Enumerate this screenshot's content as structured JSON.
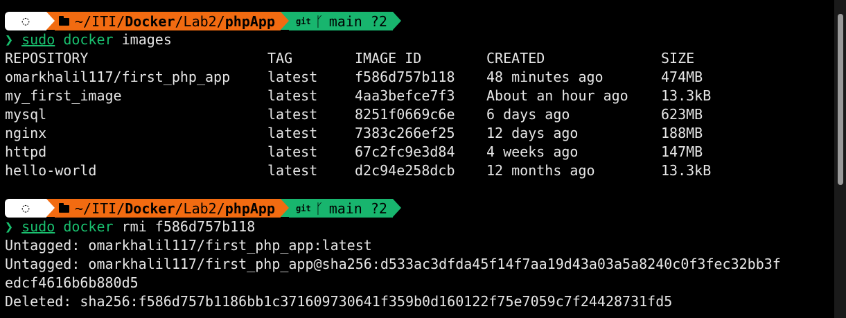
{
  "prompt": {
    "path_prefix": "~/ITI/",
    "path_docker": "Docker",
    "path_sep": "/Lab2/",
    "path_app": "phpApp",
    "git_label": "git",
    "branch": "main ?2",
    "chevron": "❯"
  },
  "command1": {
    "sudo": "sudo",
    "docker": "docker",
    "args": "images"
  },
  "images_table": {
    "headers": [
      "REPOSITORY",
      "TAG",
      "IMAGE ID",
      "CREATED",
      "SIZE"
    ],
    "rows": [
      [
        "omarkhalil117/first_php_app",
        "latest",
        "f586d757b118",
        "48 minutes ago",
        "474MB"
      ],
      [
        "my_first_image",
        "latest",
        "4aa3befce7f3",
        "About an hour ago",
        "13.3kB"
      ],
      [
        "mysql",
        "latest",
        "8251f0669c6e",
        "6 days ago",
        "623MB"
      ],
      [
        "nginx",
        "latest",
        "7383c266ef25",
        "12 days ago",
        "188MB"
      ],
      [
        "httpd",
        "latest",
        "67c2fc9e3d84",
        "4 weeks ago",
        "147MB"
      ],
      [
        "hello-world",
        "latest",
        "d2c94e258dcb",
        "12 months ago",
        "13.3kB"
      ]
    ]
  },
  "command2": {
    "sudo": "sudo",
    "docker": "docker",
    "args": "rmi f586d757b118"
  },
  "output2": [
    "Untagged: omarkhalil117/first_php_app:latest",
    "Untagged: omarkhalil117/first_php_app@sha256:d533ac3dfda45f14f7aa19d43a03a5a8240c0f3fec32bb3f",
    "edcf4616b6b880d5",
    "Deleted: sha256:f586d757b1186bb1c371609730641f359b0d160122f75e7059c7f24428731fd5"
  ]
}
